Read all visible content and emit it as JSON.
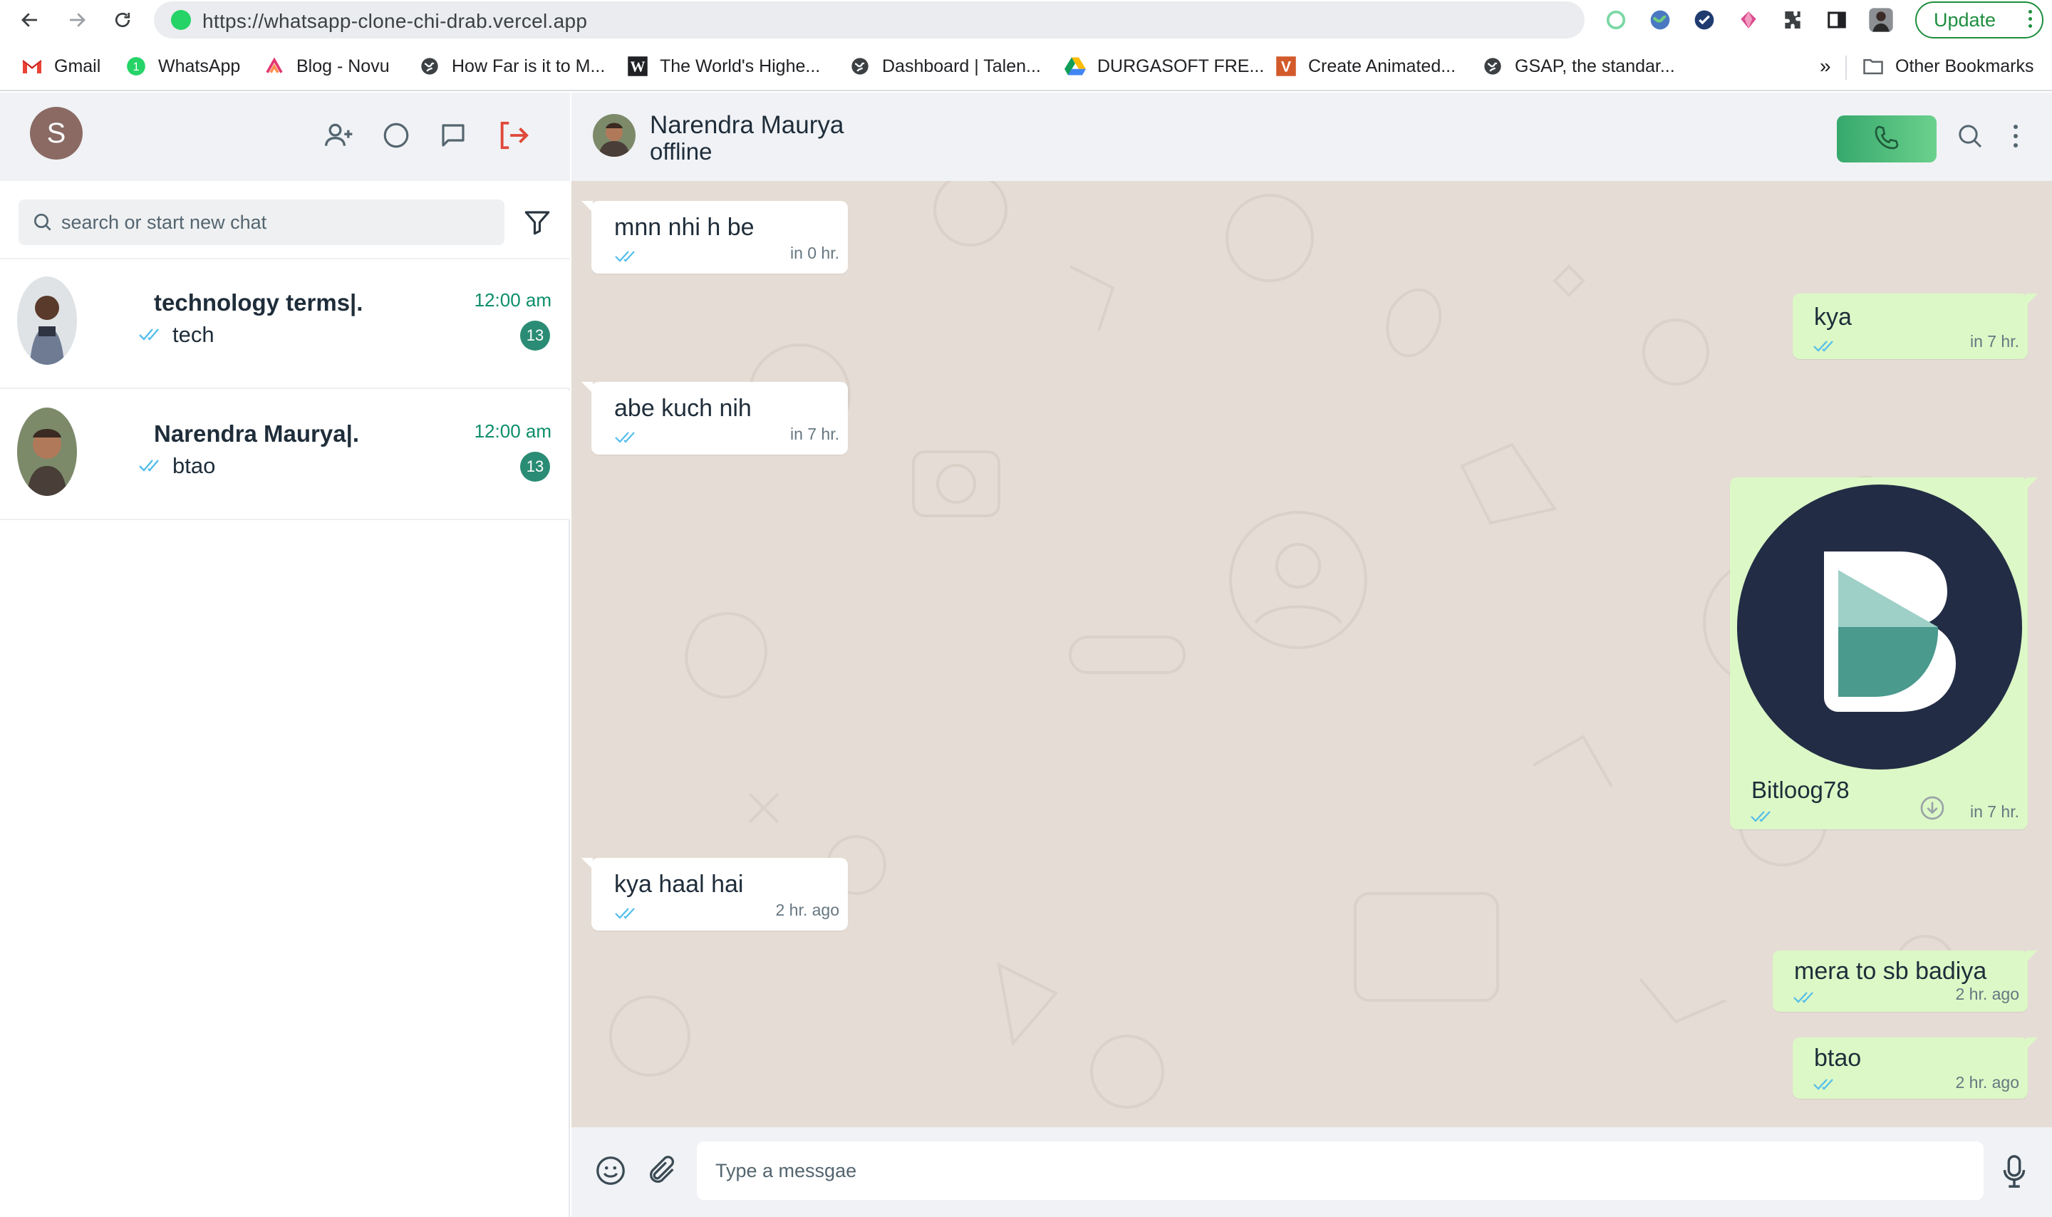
{
  "browser": {
    "url": "https://whatsapp-clone-chi-drab.vercel.app",
    "update_label": "Update",
    "bookmarks": [
      {
        "label": "Gmail",
        "icon": "gmail-icon"
      },
      {
        "label": "WhatsApp",
        "icon": "whatsapp-icon"
      },
      {
        "label": "Blog - Novu",
        "icon": "novu-icon"
      },
      {
        "label": "How Far is it to M...",
        "icon": "globe-icon"
      },
      {
        "label": "The World's Highe...",
        "icon": "w-logo-icon"
      },
      {
        "label": "Dashboard | Talen...",
        "icon": "globe-icon"
      },
      {
        "label": "DURGASOFT FRE...",
        "icon": "google-drive-icon"
      },
      {
        "label": "Create Animated...",
        "icon": "v-logo-icon"
      },
      {
        "label": "GSAP, the standar...",
        "icon": "globe-icon"
      }
    ],
    "overflow_label": "»",
    "other_bookmarks_label": "Other Bookmarks"
  },
  "sidebar": {
    "user_initial": "S",
    "search_placeholder": "search or start new chat",
    "chats": [
      {
        "name": "technology terms|.",
        "last_message": "tech",
        "time": "12:00 am",
        "unread": "13"
      },
      {
        "name": "Narendra Maurya|.",
        "last_message": "btao",
        "time": "12:00 am",
        "unread": "13"
      }
    ]
  },
  "conversation": {
    "contact_name": "Narendra Maurya",
    "status": "offline",
    "messages": [
      {
        "dir": "in",
        "text": "mnn nhi h be",
        "time": "in 0 hr."
      },
      {
        "dir": "out",
        "text": "kya",
        "time": "in 7 hr."
      },
      {
        "dir": "in",
        "text": "abe kuch nih",
        "time": "in 7 hr."
      },
      {
        "dir": "out",
        "type": "image",
        "text": "Bitloog78",
        "time": "in 7 hr."
      },
      {
        "dir": "in",
        "text": "kya haal hai",
        "time": "2 hr. ago"
      },
      {
        "dir": "out",
        "text": "mera to sb badiya",
        "time": "2 hr. ago"
      },
      {
        "dir": "out",
        "text": "btao",
        "time": "2 hr. ago"
      }
    ],
    "composer_placeholder": "Type a messgae"
  },
  "colors": {
    "accent_green": "#0c8e6a",
    "badge": "#2a8c74",
    "incoming_bubble": "#ffffff",
    "outgoing_bubble": "#dcf8c6",
    "chat_background": "#e5ddd5",
    "logout_red": "#e0483a",
    "tick_blue": "#53bdeb"
  }
}
